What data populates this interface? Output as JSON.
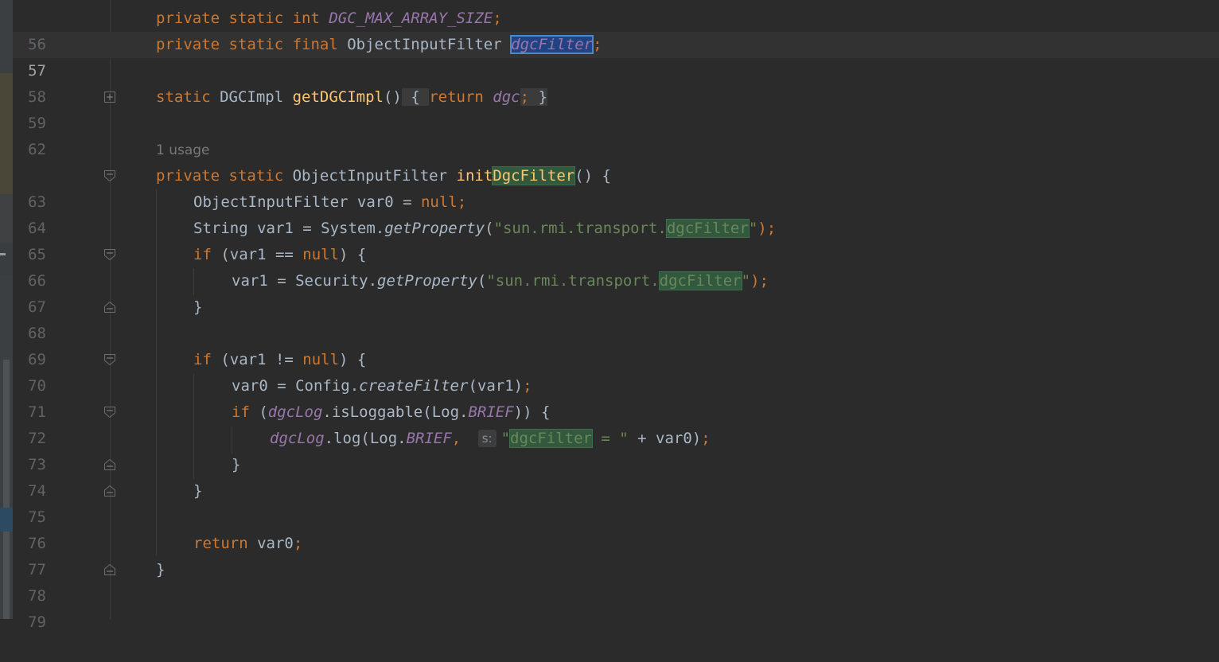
{
  "editor": {
    "usage_hint": "1 usage",
    "current_line": "57"
  },
  "lines": [
    {
      "no": "56",
      "t": {
        "a": "private static int ",
        "b": "DGC_MAX_ARRAY_SIZE",
        "c": ";"
      }
    },
    {
      "no": "57",
      "t": {
        "a": "private static final ",
        "b": "ObjectInputFilter ",
        "c": "dgcFilter",
        "d": ";"
      }
    },
    {
      "no": "58"
    },
    {
      "no": "59",
      "t": {
        "a": "static ",
        "b": "DGCImpl ",
        "c": "getDGCImpl",
        "d": "()",
        "e": " { ",
        "f": "return ",
        "g": "dgc",
        "h": "; ",
        "i": "}"
      }
    },
    {
      "no": "62"
    },
    {
      "no": "63",
      "t": {
        "a": "private static ",
        "b": "ObjectInputFilter ",
        "c": "init",
        "d": "DgcFilter",
        "e": "() {"
      }
    },
    {
      "no": "64",
      "t": {
        "a": "ObjectInputFilter var0 = ",
        "b": "null",
        "c": ";"
      }
    },
    {
      "no": "65",
      "t": {
        "a": "String var1 = System.",
        "b": "getProperty",
        "c": "(",
        "d": "\"sun.rmi.transport.",
        "e": "dgcFilter",
        "f": "\"",
        "g": ");"
      }
    },
    {
      "no": "66",
      "t": {
        "a": "if ",
        "b": "(var1 == ",
        "c": "null",
        "d": ") {"
      }
    },
    {
      "no": "67",
      "t": {
        "a": "var1 = Security.",
        "b": "getProperty",
        "c": "(",
        "d": "\"sun.rmi.transport.",
        "e": "dgcFilter",
        "f": "\"",
        "g": ");"
      }
    },
    {
      "no": "68",
      "t": {
        "a": "}"
      }
    },
    {
      "no": "69"
    },
    {
      "no": "70",
      "t": {
        "a": "if ",
        "b": "(var1 != ",
        "c": "null",
        "d": ") {"
      }
    },
    {
      "no": "71",
      "t": {
        "a": "var0 = Config.",
        "b": "createFilter",
        "c": "(var1)",
        "d": ";"
      }
    },
    {
      "no": "72",
      "t": {
        "a": "if ",
        "b": "(",
        "c": "dgcLog",
        "d": ".isLoggable(Log.",
        "e": "BRIEF",
        "f": ")) {"
      }
    },
    {
      "no": "73",
      "t": {
        "a": "dgcLog",
        "b": ".log(Log.",
        "c": "BRIEF",
        "d": ", ",
        "e": "s:",
        "f": "\"",
        "g": "dgcFilter",
        "h": " = \"",
        "i": " + var0)",
        "j": ";"
      }
    },
    {
      "no": "74",
      "t": {
        "a": "}"
      }
    },
    {
      "no": "75",
      "t": {
        "a": "}"
      }
    },
    {
      "no": "76"
    },
    {
      "no": "77",
      "t": {
        "a": "return ",
        "b": "var0",
        "c": ";"
      }
    },
    {
      "no": "78",
      "t": {
        "a": "}"
      }
    },
    {
      "no": "79"
    }
  ]
}
